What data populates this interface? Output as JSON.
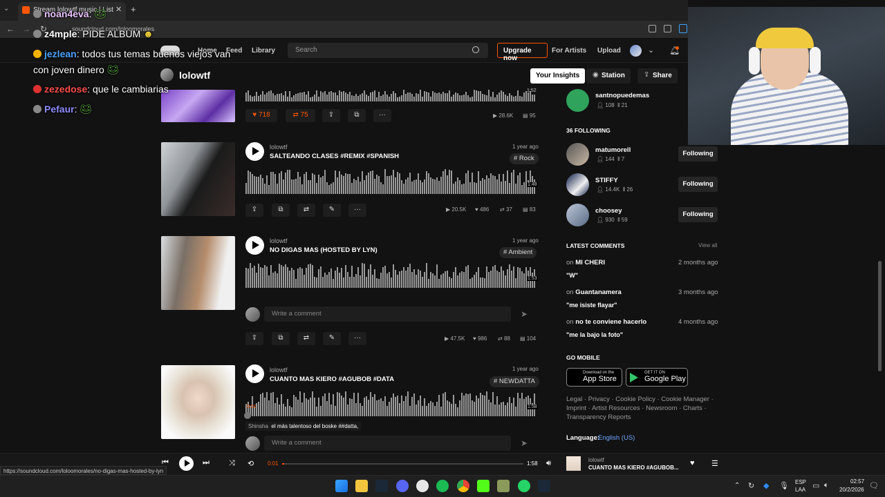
{
  "browser": {
    "tab_title": "Stream lolowtf music | List",
    "url": "soundcloud.com/loloomorales",
    "status_link": "https://soundcloud.com/loloomorales/no-digas-mas-hosted-by-lyn"
  },
  "header": {
    "nav": [
      "Home",
      "Feed",
      "Library"
    ],
    "search_placeholder": "Search",
    "upgrade": "Upgrade now",
    "for_artists": "For Artists",
    "upload": "Upload"
  },
  "profile": {
    "name": "lolowtf",
    "insights": "Your Insights",
    "station": "Station",
    "share": "Share"
  },
  "chat": [
    {
      "user": "noan4eva",
      "text": ":",
      "color": "#e8c2ff"
    },
    {
      "user": "z4mple",
      "text": ": PIDE ALBUM",
      "color": "#f2f2f2"
    },
    {
      "user": "jezlean",
      "text": ": todos tus temas buenos viejos van",
      "color": "#4da3ff"
    },
    {
      "user": "",
      "text": "con joven dinero",
      "color": "#fff"
    },
    {
      "user": "zezedose",
      "text": ": que le cambiarias",
      "color": "#ff4d4d"
    },
    {
      "user": "Pefaur",
      "text": ":",
      "color": "#8e8cff"
    }
  ],
  "top_track": {
    "likes": "718",
    "reposts": "75",
    "plays": "28.6K",
    "comments": "95",
    "duration": "1:52"
  },
  "tracks": [
    {
      "uploader": "lolowtf",
      "title": "SALTEANDO CLASES #REMIX #SPANISH",
      "ago": "1 year ago",
      "tag": "# Rock",
      "duration": "1:48",
      "plays": "20.5K",
      "likes": "486",
      "reposts": "37",
      "comments": "83"
    },
    {
      "uploader": "lolowtf",
      "title": "NO DIGAS MAS (HOSTED BY LYN)",
      "ago": "1 year ago",
      "tag": "# Ambient",
      "duration": "1:53",
      "plays": "47.5K",
      "likes": "986",
      "reposts": "88",
      "comments": "104",
      "comment_placeholder": "Write a comment"
    },
    {
      "uploader": "lolowtf",
      "title": "CUANTO MAS KIERO #AGUBOB #DATA",
      "ago": "1 year ago",
      "tag": "# NEWDATTA",
      "duration": "1:58",
      "current": "0:01",
      "comment_user": "Shinsha",
      "comment_text": "el más talentoso del boske ##datta,",
      "comment_placeholder": "Write a comment"
    }
  ],
  "sidebar": {
    "top_user": {
      "name": "santnopuedemas",
      "followers": "108",
      "tracks": "21"
    },
    "following_title": "36 FOLLOWING",
    "following": [
      {
        "name": "matumorell",
        "followers": "144",
        "tracks": "7",
        "button": "Following"
      },
      {
        "name": "STIFFY",
        "followers": "14.4K",
        "tracks": "26",
        "button": "Following"
      },
      {
        "name": "choosey",
        "followers": "930",
        "tracks": "59",
        "button": "Following"
      }
    ],
    "comments_title": "LATEST COMMENTS",
    "view_all": "View all",
    "comments": [
      {
        "on": "on",
        "track": "MI CHERI",
        "time": "2 months ago",
        "text": "\"W\""
      },
      {
        "on": "on",
        "track": "Guantanamera",
        "time": "3 months ago",
        "text": "\"me isiste flayar\""
      },
      {
        "on": "on",
        "track": "no te conviene hacerlo",
        "time": "4 months ago",
        "text": "\"me la bajo la foto\""
      }
    ],
    "go_mobile": "GO MOBILE",
    "app_store": {
      "small": "Download on the",
      "big": "App Store"
    },
    "google_play": {
      "small": "GET IT ON",
      "big": "Google Play"
    },
    "footer_line1": "Legal · Privacy · Cookie Policy · Cookie Manager ·",
    "footer_line2": "Imprint · Artist Resources · Newsroom · Charts ·",
    "footer_line3": "Transparency Reports",
    "language_label": "Language:",
    "language_value": "English (US)"
  },
  "player": {
    "current": "0:01",
    "duration": "1:58",
    "progress": 0.01,
    "artist": "lolowtf",
    "title": "CUANTO MAS KIERO #AGUBOB..."
  },
  "taskbar": {
    "lang1": "ESP",
    "lang2": "LAA",
    "time": "02:57",
    "date": "20/2/2026"
  },
  "colors": {
    "accent": "#ff5500",
    "background": "#121212"
  }
}
